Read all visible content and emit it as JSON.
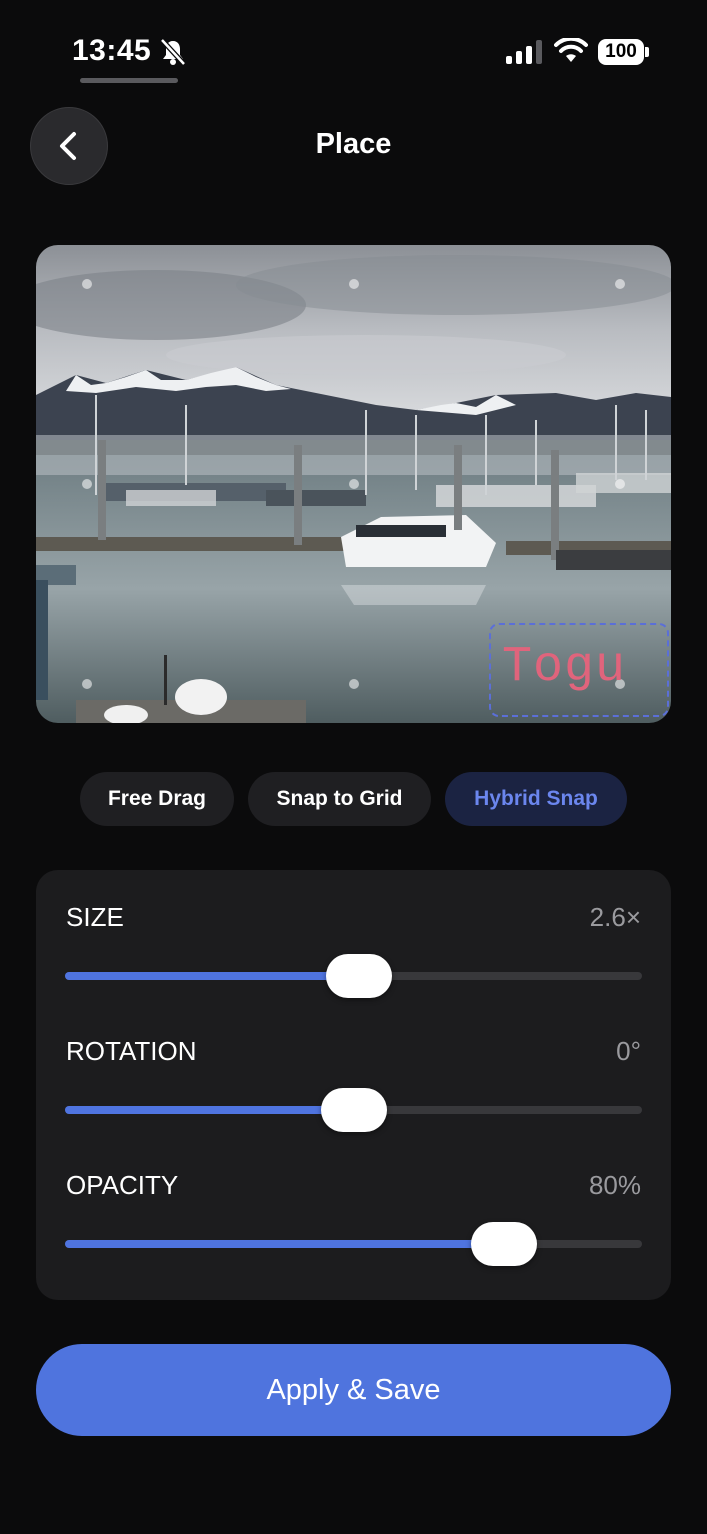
{
  "status_bar": {
    "time": "13:45",
    "battery": "100",
    "icons": [
      "bell-slash-icon",
      "cellular-signal-icon",
      "wifi-icon",
      "battery-icon"
    ]
  },
  "header": {
    "title": "Place",
    "back_icon": "chevron-left-icon"
  },
  "preview": {
    "watermark_text": "Togu",
    "watermark_color": "#e0647c",
    "selection_color": "#5b6fd8"
  },
  "modes": [
    {
      "label": "Free Drag",
      "selected": false
    },
    {
      "label": "Snap to Grid",
      "selected": false
    },
    {
      "label": "Hybrid Snap",
      "selected": true
    }
  ],
  "controls": {
    "size": {
      "label": "SIZE",
      "value": "2.6×",
      "fraction": 0.51
    },
    "rotation": {
      "label": "ROTATION",
      "value": "0°",
      "fraction": 0.5
    },
    "opacity": {
      "label": "OPACITY",
      "value": "80%",
      "fraction": 0.76
    }
  },
  "apply_button": {
    "label": "Apply & Save"
  },
  "colors": {
    "accent": "#4f74de",
    "background": "#0b0b0c",
    "panel": "#1c1c1e"
  }
}
